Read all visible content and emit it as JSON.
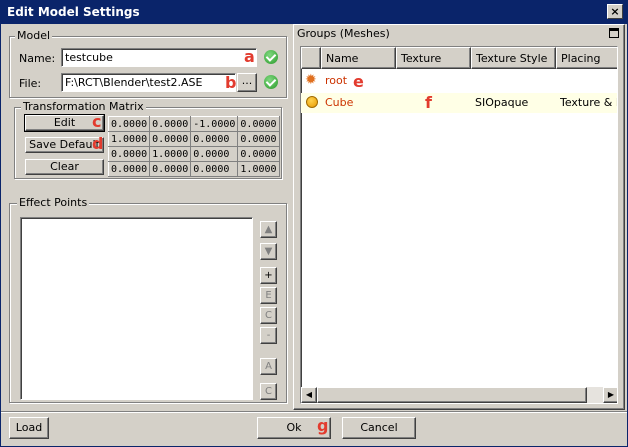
{
  "window": {
    "title": "Edit Model Settings",
    "close_glyph": "×"
  },
  "model": {
    "group_label": "Model",
    "name_label": "Name:",
    "name_value": "testcube",
    "file_label": "File:",
    "file_value": "F:\\RCT\\Blender\\test2.ASE",
    "browse_label": "..."
  },
  "transform": {
    "group_label": "Transformation Matrix",
    "edit_label": "Edit",
    "save_default_label": "Save Default",
    "clear_label": "Clear",
    "matrix": [
      [
        "0.0000",
        "0.0000",
        "-1.0000",
        "0.0000"
      ],
      [
        "1.0000",
        "0.0000",
        "0.0000",
        "0.0000"
      ],
      [
        "0.0000",
        "1.0000",
        "0.0000",
        "0.0000"
      ],
      [
        "0.0000",
        "0.0000",
        "0.0000",
        "1.0000"
      ]
    ]
  },
  "effects": {
    "group_label": "Effect Points",
    "side_buttons": [
      "▲",
      "▼",
      "+",
      "E",
      "C",
      "-",
      "A",
      "C"
    ]
  },
  "groups": {
    "title": "Groups (Meshes)",
    "columns": [
      "Name",
      "Texture",
      "Texture Style",
      "Placing"
    ],
    "rows": [
      {
        "name": "root",
        "texture": "",
        "style": "",
        "placing": "",
        "icon": "gear-icon",
        "color": "#cc3300"
      },
      {
        "name": "Cube",
        "texture": "",
        "style": "SIOpaque",
        "placing": "Texture & M",
        "icon": "orange-circle-icon",
        "color": "#cc3300"
      }
    ]
  },
  "footer": {
    "load_label": "Load",
    "ok_label": "Ok",
    "cancel_label": "Cancel"
  },
  "annotations": {
    "a": "a",
    "b": "b",
    "c": "c",
    "d": "d",
    "e": "e",
    "f": "f",
    "g": "g"
  },
  "colors": {
    "title_bg": "#0a246a",
    "face": "#d4d0c8",
    "annotation": "#e23b2e",
    "selected_row": "#ffffe6"
  }
}
